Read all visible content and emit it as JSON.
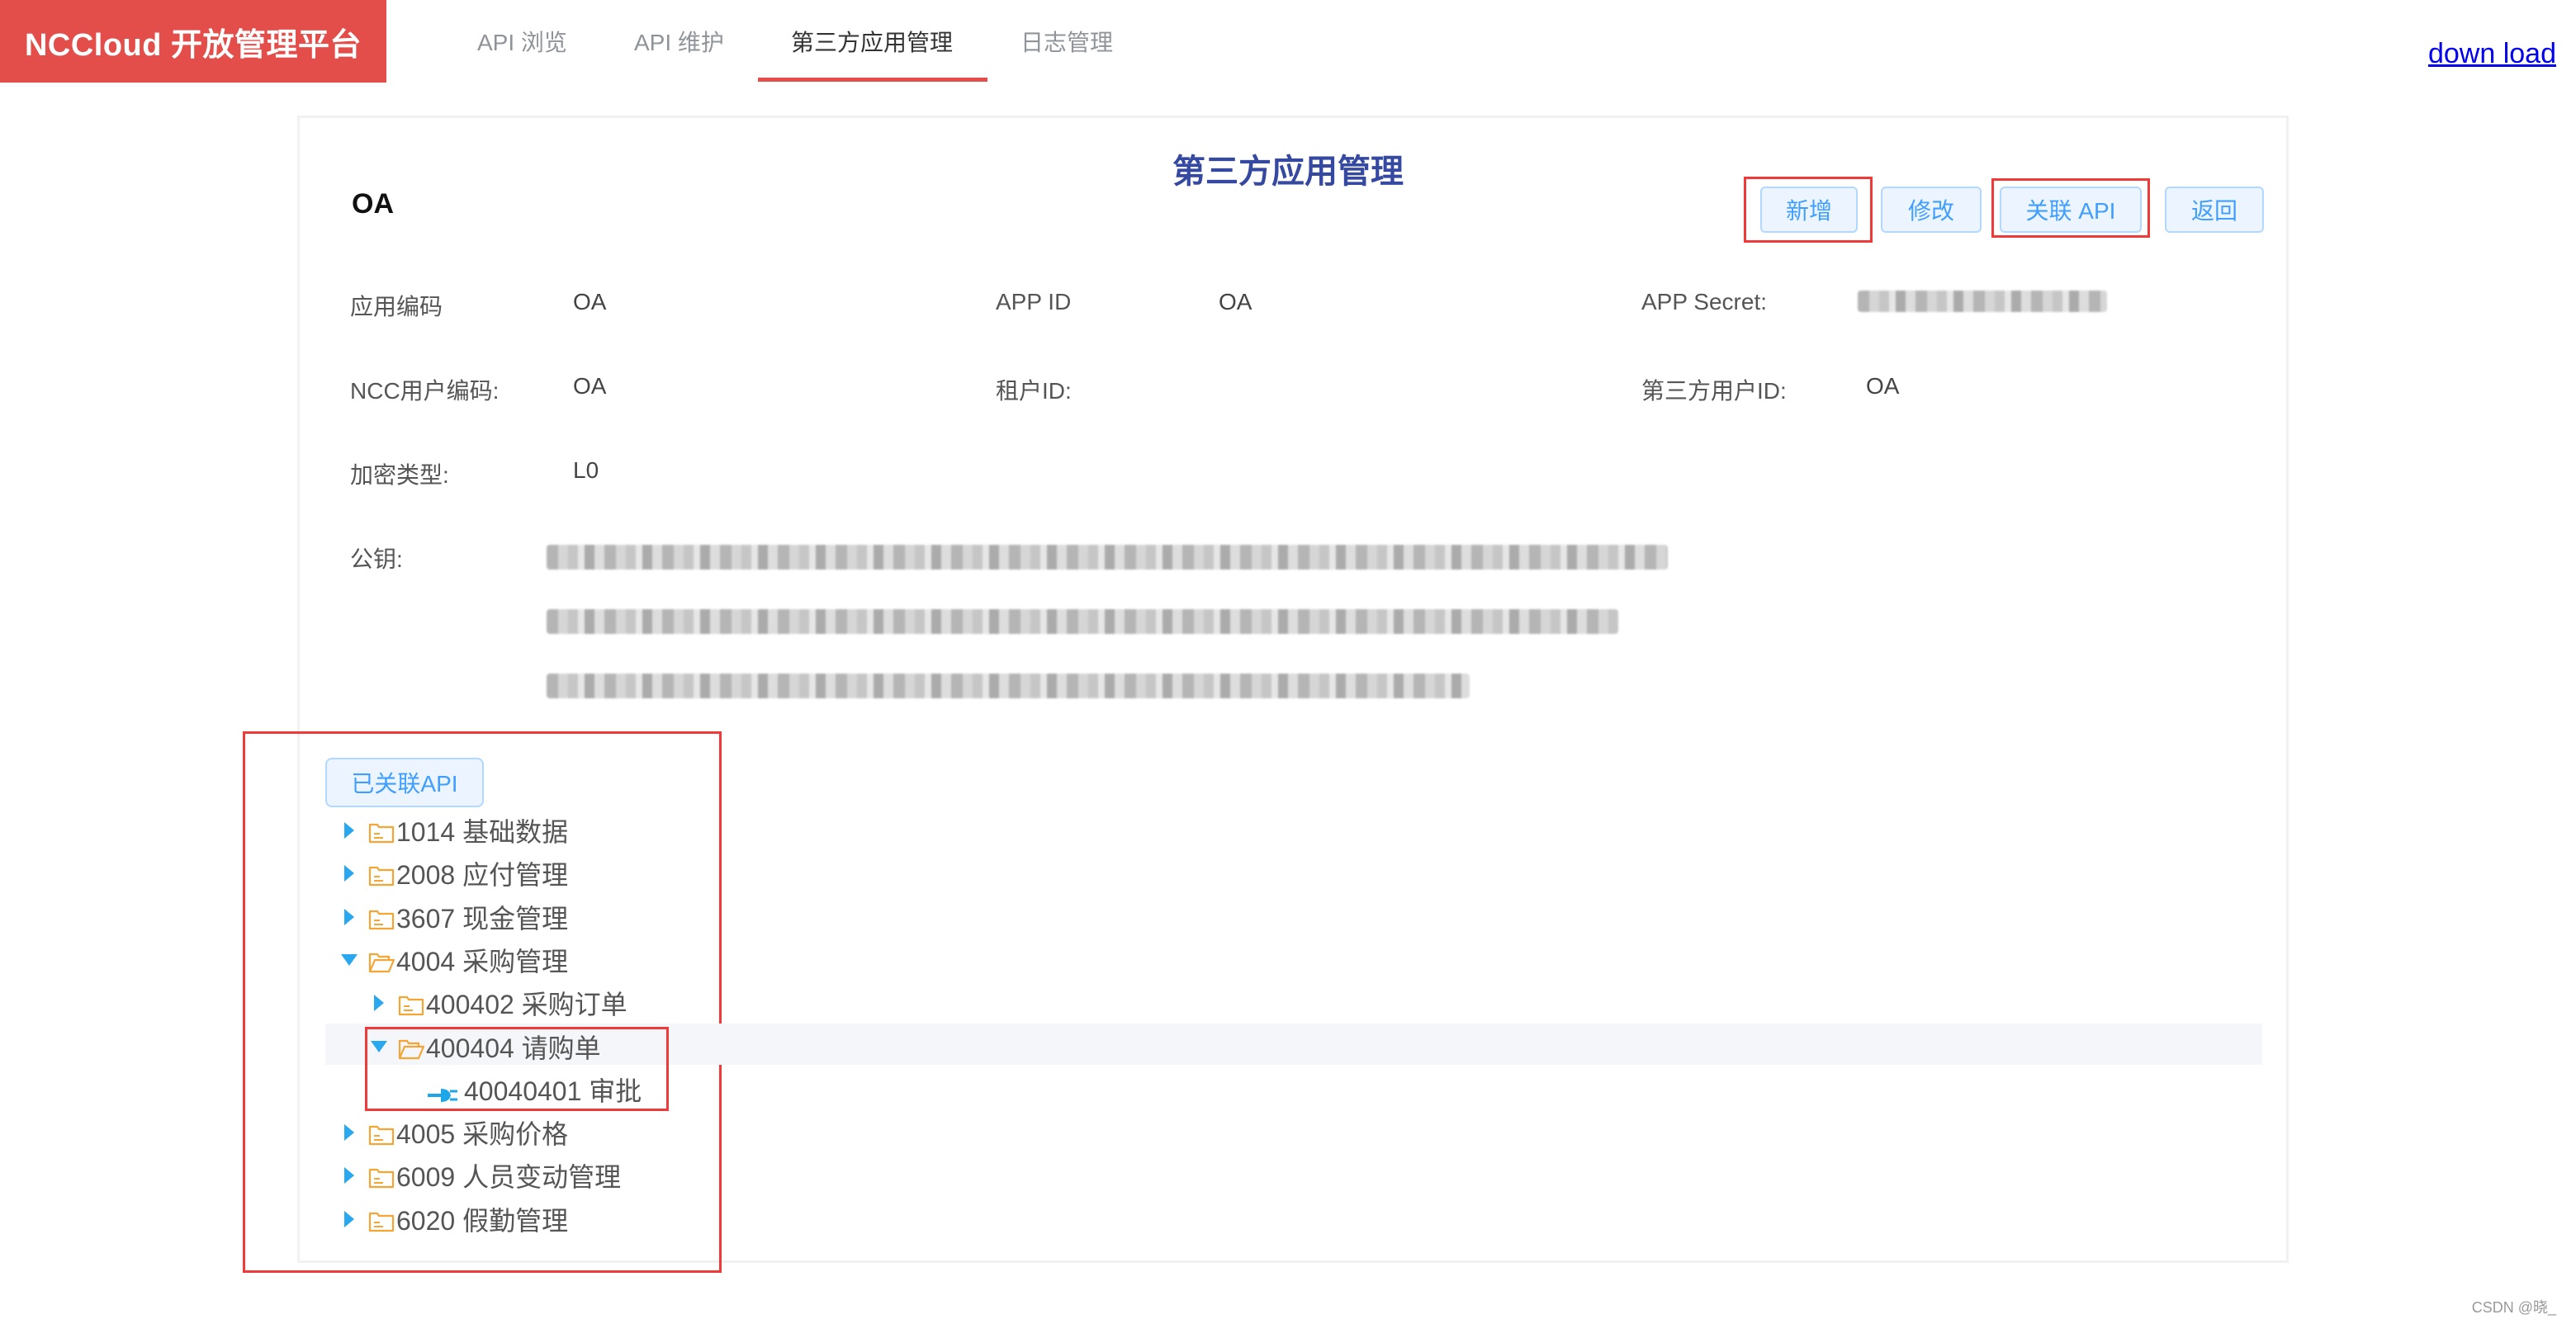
{
  "header": {
    "brand": "NCCloud 开放管理平台",
    "tabs": [
      {
        "label": "API 浏览",
        "active": false
      },
      {
        "label": "API 维护",
        "active": false
      },
      {
        "label": "第三方应用管理",
        "active": true
      },
      {
        "label": "日志管理",
        "active": false
      }
    ],
    "download_link": "down load"
  },
  "page": {
    "title": "第三方应用管理",
    "app_name": "OA",
    "buttons": {
      "add": "新增",
      "edit": "修改",
      "link_api": "关联 API",
      "back": "返回"
    }
  },
  "fields": {
    "app_code_label": "应用编码",
    "app_code_value": "OA",
    "app_id_label": "APP ID",
    "app_id_value": "OA",
    "app_secret_label": "APP Secret:",
    "app_secret_value": "[redacted]",
    "ncc_user_code_label": "NCC用户编码:",
    "ncc_user_code_value": "OA",
    "tenant_id_label": "租户ID:",
    "tenant_id_value": "",
    "third_user_id_label": "第三方用户ID:",
    "third_user_id_value": "OA",
    "encrypt_type_label": "加密类型:",
    "encrypt_type_value": "L0",
    "public_key_label": "公钥:",
    "public_key_value": "[redacted]"
  },
  "linked_api": {
    "tag_label": "已关联API",
    "tree": [
      {
        "label": "1014 基础数据",
        "level": 0,
        "type": "folder",
        "expanded": false
      },
      {
        "label": "2008 应付管理",
        "level": 0,
        "type": "folder",
        "expanded": false
      },
      {
        "label": "3607 现金管理",
        "level": 0,
        "type": "folder",
        "expanded": false
      },
      {
        "label": "4004 采购管理",
        "level": 0,
        "type": "folder",
        "expanded": true
      },
      {
        "label": "400402 采购订单",
        "level": 1,
        "type": "folder",
        "expanded": false
      },
      {
        "label": "400404 请购单",
        "level": 1,
        "type": "folder",
        "expanded": true,
        "selected": true
      },
      {
        "label": "40040401 审批",
        "level": 2,
        "type": "api"
      },
      {
        "label": "4005 采购价格",
        "level": 0,
        "type": "folder",
        "expanded": false
      },
      {
        "label": "6009 人员变动管理",
        "level": 0,
        "type": "folder",
        "expanded": false
      },
      {
        "label": "6020 假勤管理",
        "level": 0,
        "type": "folder",
        "expanded": false
      }
    ]
  },
  "colors": {
    "brand": "#e34d4a",
    "title": "#3649a0",
    "button_text": "#409eff",
    "caret": "#29a8f0",
    "folder": "#f5a533",
    "highlight_box": "#f03a3a"
  },
  "watermark": "CSDN @晓_"
}
